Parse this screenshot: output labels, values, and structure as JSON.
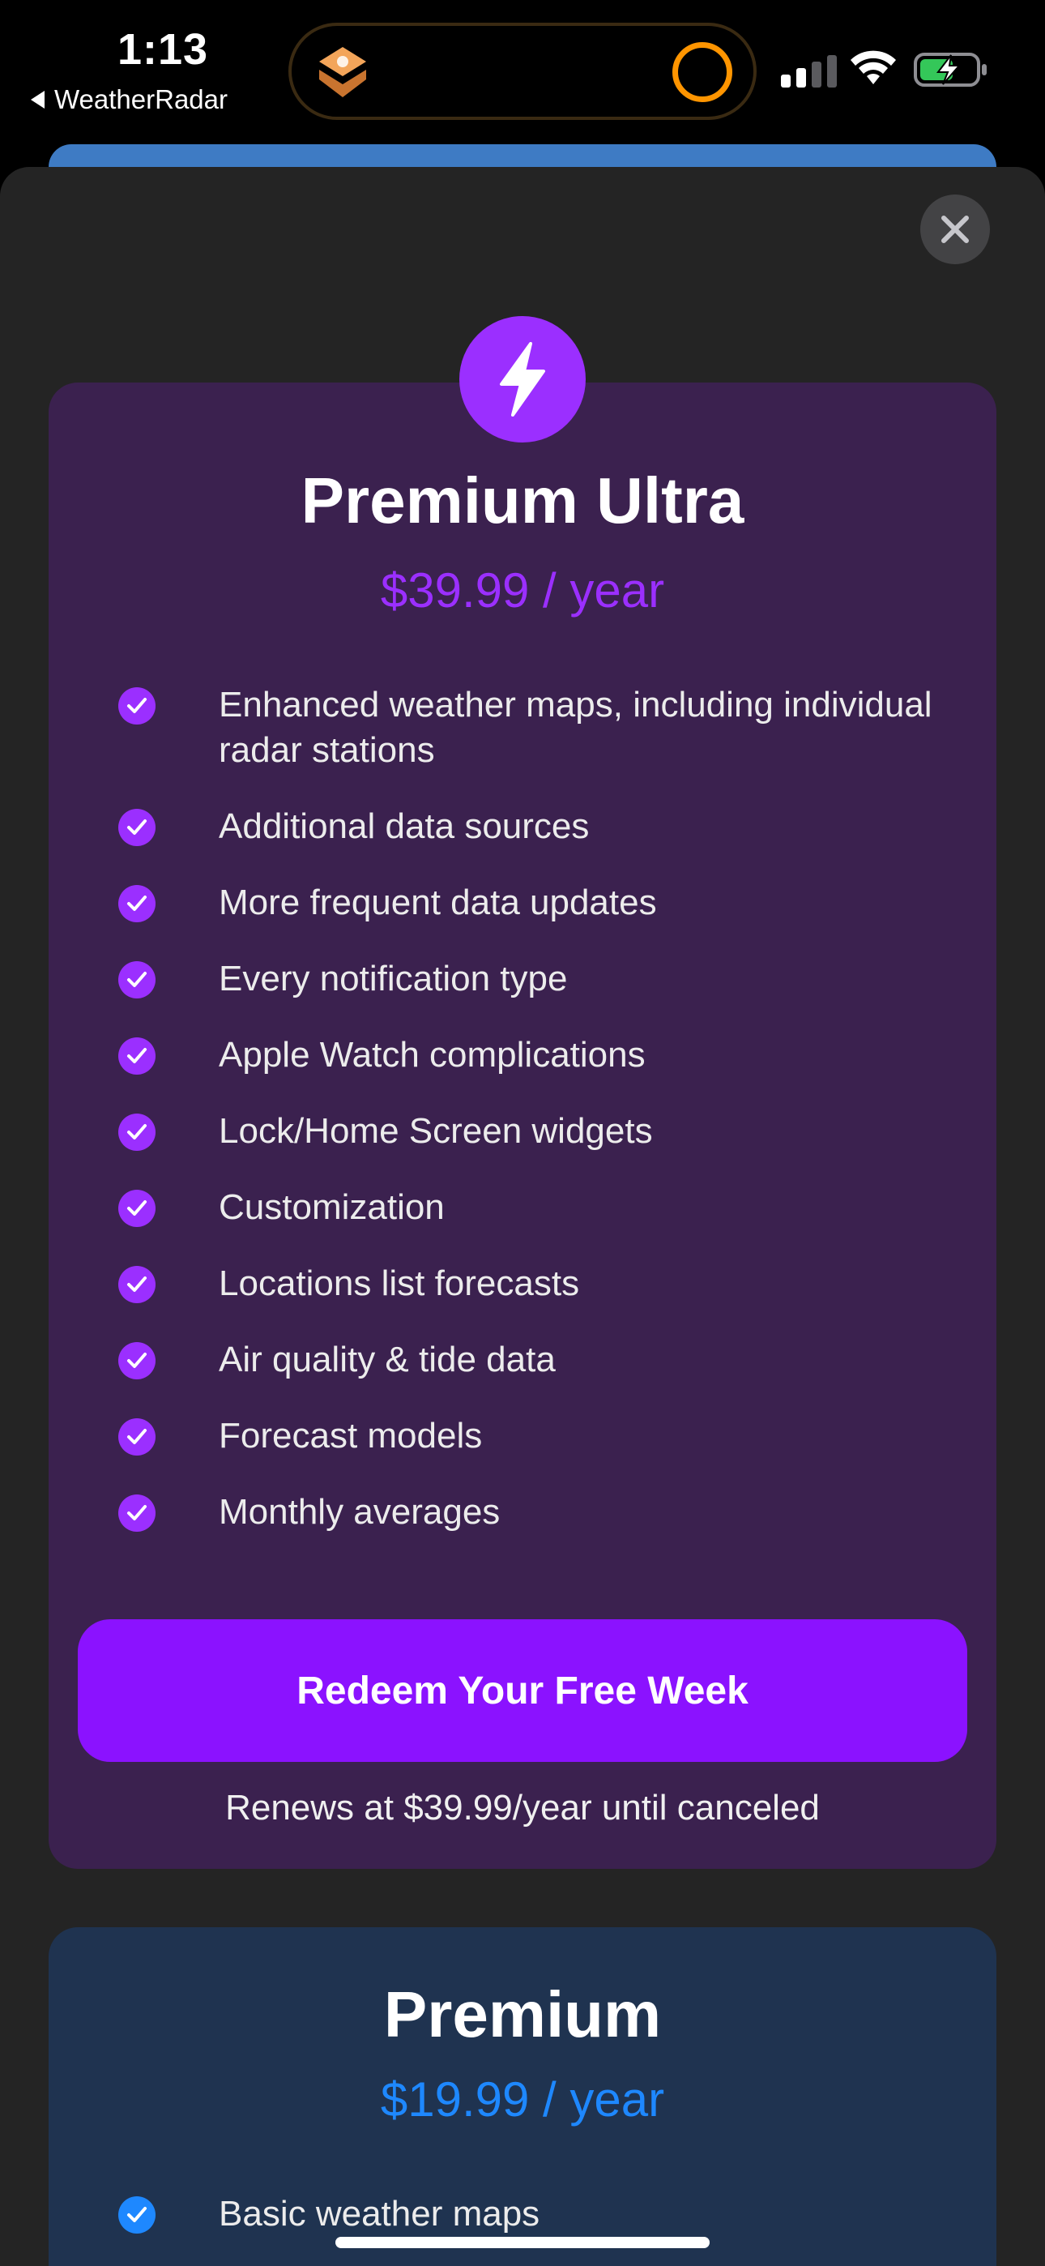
{
  "status_bar": {
    "time": "1:13",
    "back_app": "WeatherRadar",
    "island_icon": "shortcuts-app-icon",
    "island_ring_color": "#ff9500",
    "battery_state": "charging"
  },
  "sheet": {
    "close_icon": "close-icon",
    "ultra": {
      "icon": "lightning-bolt-icon",
      "title": "Premium Ultra",
      "price": "$39.99 / year",
      "accent": "#9b2fff",
      "features": [
        "Enhanced weather maps, including individual radar stations",
        "Additional data sources",
        "More frequent data updates",
        "Every notification type",
        "Apple Watch complications",
        "Lock/Home Screen widgets",
        "Customization",
        "Locations list forecasts",
        "Air quality & tide data",
        "Forecast models",
        "Monthly averages"
      ],
      "cta": "Redeem Your Free Week",
      "renew_note": "Renews at $39.99/year until canceled"
    },
    "premium": {
      "title": "Premium",
      "price": "$19.99 / year",
      "accent": "#1e88ff",
      "features": [
        "Basic weather maps"
      ]
    }
  }
}
